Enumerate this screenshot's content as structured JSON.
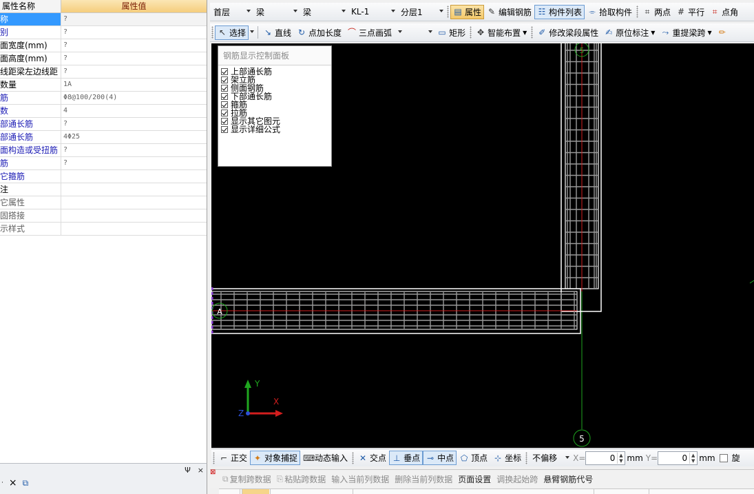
{
  "property_panel": {
    "header": {
      "col_name": "属性名称",
      "col_value": "属性值"
    },
    "rows": [
      {
        "name": "称",
        "value": "?",
        "style": "blue",
        "selected": true
      },
      {
        "name": "别",
        "value": "?",
        "style": "blue"
      },
      {
        "name": "面宽度(mm)",
        "value": "?",
        "style": "normal"
      },
      {
        "name": "面高度(mm)",
        "value": "?",
        "style": "normal"
      },
      {
        "name": "线距梁左边线距",
        "value": "?",
        "style": "normal"
      },
      {
        "name": "数量",
        "value": "1A",
        "style": "normal"
      },
      {
        "name": "筋",
        "value": "Φ8@100/200(4)",
        "style": "blue"
      },
      {
        "name": "数",
        "value": "4",
        "style": "blue"
      },
      {
        "name": "部通长筋",
        "value": "?",
        "style": "blue"
      },
      {
        "name": "部通长筋",
        "value": "4Φ25",
        "style": "blue"
      },
      {
        "name": "面构造或受扭筋",
        "value": "?",
        "style": "blue"
      },
      {
        "name": "筋",
        "value": "?",
        "style": "blue"
      },
      {
        "name": "它箍筋",
        "value": "",
        "style": "blue"
      },
      {
        "name": "注",
        "value": "",
        "style": "normal"
      },
      {
        "name": "它属性",
        "value": "",
        "style": "gray"
      },
      {
        "name": "固搭接",
        "value": "",
        "style": "gray"
      },
      {
        "name": "示样式",
        "value": "",
        "style": "gray"
      }
    ],
    "bottom_bar": {
      "pin": "Ψ",
      "close": "×",
      "delete_icon": "×",
      "copy_icon": "⧉"
    }
  },
  "toolbar1": {
    "floor": "首层",
    "category": "梁",
    "sub_category": "梁",
    "component": "KL-1",
    "layer": "分层1",
    "property_btn": "属性",
    "edit_rebar_btn": "编辑钢筋",
    "component_list_btn": "构件列表",
    "pick_btn": "拾取构件",
    "two_points_btn": "两点",
    "parallel_btn": "平行",
    "point_angle_btn": "点角"
  },
  "toolbar2": {
    "select_btn": "选择",
    "line_btn": "直线",
    "point_length_btn": "点加长度",
    "three_point_arc_btn": "三点画弧",
    "rect_btn": "矩形",
    "smart_layout_btn": "智能布置",
    "modify_span_btn": "修改梁段属性",
    "in_place_label_btn": "原位标注",
    "re_extract_span_btn": "重提梁跨"
  },
  "rebar_panel": {
    "title": "钢筋显示控制面板",
    "items": [
      {
        "label": "上部通长筋",
        "checked": true
      },
      {
        "label": "架立筋",
        "checked": true
      },
      {
        "label": "侧面钢筋",
        "checked": true
      },
      {
        "label": "下部通长筋",
        "checked": true
      },
      {
        "label": "箍筋",
        "checked": true
      },
      {
        "label": "拉筋",
        "checked": true
      },
      {
        "label": "显示其它图元",
        "checked": true
      },
      {
        "label": "显示详细公式",
        "checked": true
      }
    ]
  },
  "canvas": {
    "axis_5_label": "5",
    "axis_a_label": "A",
    "ucs_x": "X",
    "ucs_y": "Y",
    "ucs_z": "Z"
  },
  "snapbar": {
    "ortho_btn": "正交",
    "osnap_btn": "对象捕捉",
    "dyn_input_btn": "动态输入",
    "intersect_btn": "交点",
    "perpendicular_btn": "垂点",
    "midpoint_btn": "中点",
    "vertex_btn": "顶点",
    "coord_btn": "坐标",
    "offset_mode": "不偏移",
    "x_label": "X=",
    "x_value": "0",
    "x_unit": "mm",
    "y_label": "Y=",
    "y_value": "0",
    "y_unit": "mm",
    "rotate_label": "旋"
  },
  "actbar": {
    "copy_span_data": "复制跨数据",
    "paste_span_data": "粘贴跨数据",
    "input_current_col": "输入当前列数据",
    "delete_current_col": "删除当前列数据",
    "page_setup": "页面设置",
    "swap_start_span": "调换起始跨",
    "cantilever_code": "悬臂钢筋代号"
  },
  "colors": {
    "canvas_bg": "#000000",
    "axis_green": "#1fa61f",
    "beam_outline": "#ffffff",
    "rebar_gray": "#9a9a9a",
    "rebar_red": "#d21e1e",
    "selection_purple": "#8b3fd6",
    "highlight_orange": "#f4c96a"
  }
}
